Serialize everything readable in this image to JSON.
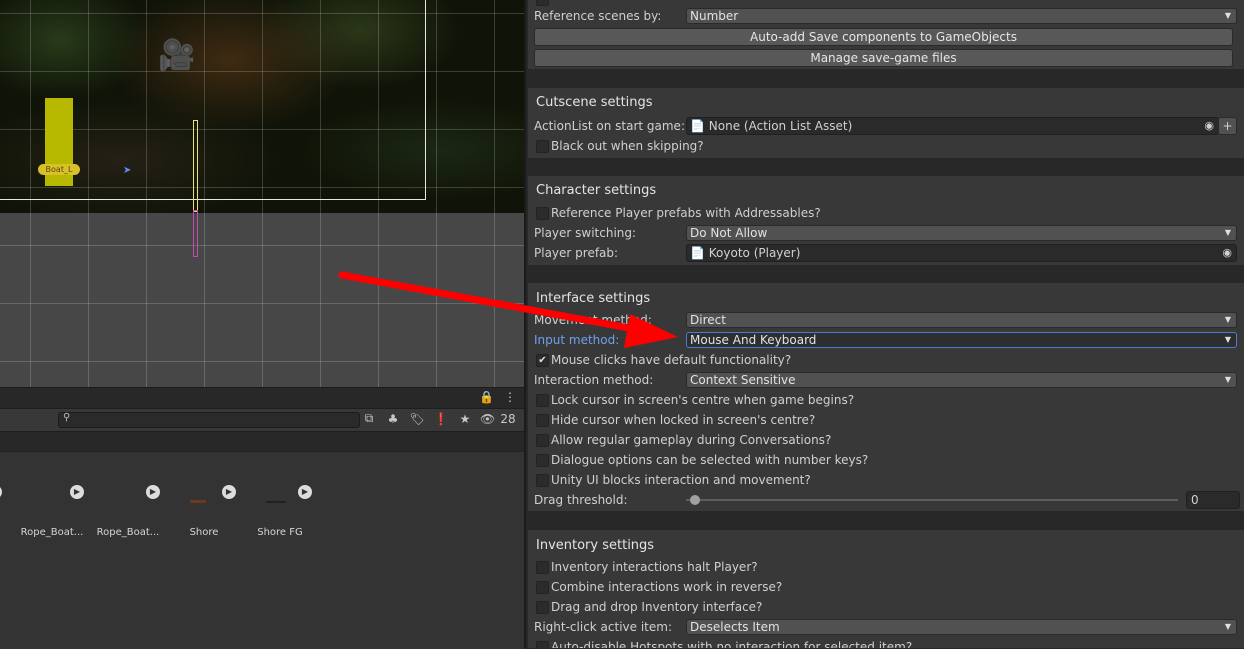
{
  "scene": {
    "object_label": "Boat_L"
  },
  "project": {
    "toolbar": {
      "search_placeholder": "",
      "hidden_count": "28"
    },
    "assets": [
      {
        "name": "Rope_Boat..."
      },
      {
        "name": "Rope_Boat..."
      },
      {
        "name": "Shore"
      },
      {
        "name": "Shore FG"
      }
    ]
  },
  "inspector": {
    "top": {
      "reference_scenes_label": "Reference scenes by:",
      "reference_scenes_value": "Number",
      "auto_add_button": "Auto-add Save components to GameObjects",
      "manage_button": "Manage save-game files"
    },
    "cutscene": {
      "title": "Cutscene settings",
      "actionlist_label": "ActionList on start game:",
      "actionlist_value": "None (Action List Asset)",
      "plus_label": "+",
      "blackout_label": "Black out when skipping?"
    },
    "character": {
      "title": "Character settings",
      "ref_addressables_label": "Reference Player prefabs with Addressables?",
      "switching_label": "Player switching:",
      "switching_value": "Do Not Allow",
      "prefab_label": "Player prefab:",
      "prefab_value": "Koyoto (Player)"
    },
    "interface": {
      "title": "Interface settings",
      "movement_label": "Movement method:",
      "movement_value": "Direct",
      "input_label": "Input method:",
      "input_value": "Mouse And Keyboard",
      "mouse_clicks_label": "Mouse clicks have default functionality?",
      "interaction_label": "Interaction method:",
      "interaction_value": "Context Sensitive",
      "lock_cursor_label": "Lock cursor in screen's centre when game begins?",
      "hide_cursor_label": "Hide cursor when locked in screen's centre?",
      "allow_gameplay_label": "Allow regular gameplay during Conversations?",
      "dialogue_keys_label": "Dialogue options can be selected with number keys?",
      "unity_ui_label": "Unity UI blocks interaction and movement?",
      "drag_label": "Drag threshold:",
      "drag_value": "0"
    },
    "inventory": {
      "title": "Inventory settings",
      "halt_label": "Inventory interactions halt Player?",
      "combine_label": "Combine interactions work in reverse?",
      "drag_drop_label": "Drag and drop Inventory interface?",
      "right_click_label": "Right-click active item:",
      "right_click_value": "Deselects Item",
      "auto_disable_label": "Auto-disable Hotspots with no interaction for selected item?"
    }
  },
  "colors": {
    "annotation_arrow": "#ff0000",
    "focus_label": "#6ea0ee"
  }
}
